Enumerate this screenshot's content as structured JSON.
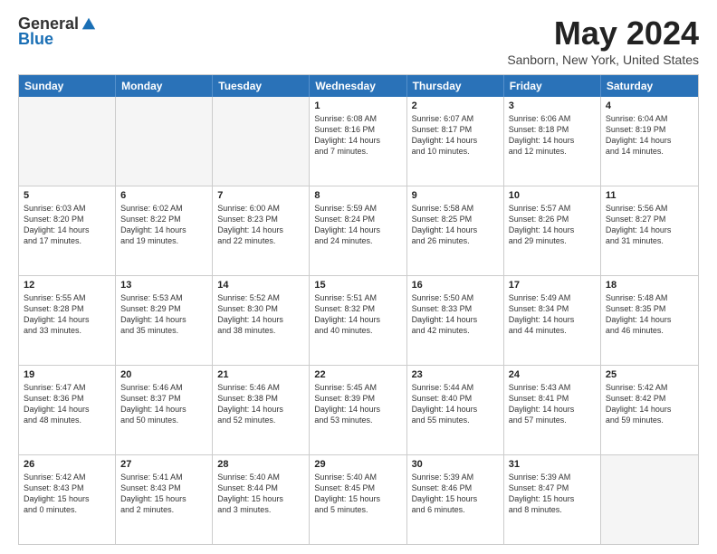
{
  "logo": {
    "general": "General",
    "blue": "Blue"
  },
  "title": "May 2024",
  "subtitle": "Sanborn, New York, United States",
  "days": [
    "Sunday",
    "Monday",
    "Tuesday",
    "Wednesday",
    "Thursday",
    "Friday",
    "Saturday"
  ],
  "rows": [
    [
      {
        "day": "",
        "content": ""
      },
      {
        "day": "",
        "content": ""
      },
      {
        "day": "",
        "content": ""
      },
      {
        "day": "1",
        "content": "Sunrise: 6:08 AM\nSunset: 8:16 PM\nDaylight: 14 hours\nand 7 minutes."
      },
      {
        "day": "2",
        "content": "Sunrise: 6:07 AM\nSunset: 8:17 PM\nDaylight: 14 hours\nand 10 minutes."
      },
      {
        "day": "3",
        "content": "Sunrise: 6:06 AM\nSunset: 8:18 PM\nDaylight: 14 hours\nand 12 minutes."
      },
      {
        "day": "4",
        "content": "Sunrise: 6:04 AM\nSunset: 8:19 PM\nDaylight: 14 hours\nand 14 minutes."
      }
    ],
    [
      {
        "day": "5",
        "content": "Sunrise: 6:03 AM\nSunset: 8:20 PM\nDaylight: 14 hours\nand 17 minutes."
      },
      {
        "day": "6",
        "content": "Sunrise: 6:02 AM\nSunset: 8:22 PM\nDaylight: 14 hours\nand 19 minutes."
      },
      {
        "day": "7",
        "content": "Sunrise: 6:00 AM\nSunset: 8:23 PM\nDaylight: 14 hours\nand 22 minutes."
      },
      {
        "day": "8",
        "content": "Sunrise: 5:59 AM\nSunset: 8:24 PM\nDaylight: 14 hours\nand 24 minutes."
      },
      {
        "day": "9",
        "content": "Sunrise: 5:58 AM\nSunset: 8:25 PM\nDaylight: 14 hours\nand 26 minutes."
      },
      {
        "day": "10",
        "content": "Sunrise: 5:57 AM\nSunset: 8:26 PM\nDaylight: 14 hours\nand 29 minutes."
      },
      {
        "day": "11",
        "content": "Sunrise: 5:56 AM\nSunset: 8:27 PM\nDaylight: 14 hours\nand 31 minutes."
      }
    ],
    [
      {
        "day": "12",
        "content": "Sunrise: 5:55 AM\nSunset: 8:28 PM\nDaylight: 14 hours\nand 33 minutes."
      },
      {
        "day": "13",
        "content": "Sunrise: 5:53 AM\nSunset: 8:29 PM\nDaylight: 14 hours\nand 35 minutes."
      },
      {
        "day": "14",
        "content": "Sunrise: 5:52 AM\nSunset: 8:30 PM\nDaylight: 14 hours\nand 38 minutes."
      },
      {
        "day": "15",
        "content": "Sunrise: 5:51 AM\nSunset: 8:32 PM\nDaylight: 14 hours\nand 40 minutes."
      },
      {
        "day": "16",
        "content": "Sunrise: 5:50 AM\nSunset: 8:33 PM\nDaylight: 14 hours\nand 42 minutes."
      },
      {
        "day": "17",
        "content": "Sunrise: 5:49 AM\nSunset: 8:34 PM\nDaylight: 14 hours\nand 44 minutes."
      },
      {
        "day": "18",
        "content": "Sunrise: 5:48 AM\nSunset: 8:35 PM\nDaylight: 14 hours\nand 46 minutes."
      }
    ],
    [
      {
        "day": "19",
        "content": "Sunrise: 5:47 AM\nSunset: 8:36 PM\nDaylight: 14 hours\nand 48 minutes."
      },
      {
        "day": "20",
        "content": "Sunrise: 5:46 AM\nSunset: 8:37 PM\nDaylight: 14 hours\nand 50 minutes."
      },
      {
        "day": "21",
        "content": "Sunrise: 5:46 AM\nSunset: 8:38 PM\nDaylight: 14 hours\nand 52 minutes."
      },
      {
        "day": "22",
        "content": "Sunrise: 5:45 AM\nSunset: 8:39 PM\nDaylight: 14 hours\nand 53 minutes."
      },
      {
        "day": "23",
        "content": "Sunrise: 5:44 AM\nSunset: 8:40 PM\nDaylight: 14 hours\nand 55 minutes."
      },
      {
        "day": "24",
        "content": "Sunrise: 5:43 AM\nSunset: 8:41 PM\nDaylight: 14 hours\nand 57 minutes."
      },
      {
        "day": "25",
        "content": "Sunrise: 5:42 AM\nSunset: 8:42 PM\nDaylight: 14 hours\nand 59 minutes."
      }
    ],
    [
      {
        "day": "26",
        "content": "Sunrise: 5:42 AM\nSunset: 8:43 PM\nDaylight: 15 hours\nand 0 minutes."
      },
      {
        "day": "27",
        "content": "Sunrise: 5:41 AM\nSunset: 8:43 PM\nDaylight: 15 hours\nand 2 minutes."
      },
      {
        "day": "28",
        "content": "Sunrise: 5:40 AM\nSunset: 8:44 PM\nDaylight: 15 hours\nand 3 minutes."
      },
      {
        "day": "29",
        "content": "Sunrise: 5:40 AM\nSunset: 8:45 PM\nDaylight: 15 hours\nand 5 minutes."
      },
      {
        "day": "30",
        "content": "Sunrise: 5:39 AM\nSunset: 8:46 PM\nDaylight: 15 hours\nand 6 minutes."
      },
      {
        "day": "31",
        "content": "Sunrise: 5:39 AM\nSunset: 8:47 PM\nDaylight: 15 hours\nand 8 minutes."
      },
      {
        "day": "",
        "content": ""
      }
    ]
  ]
}
